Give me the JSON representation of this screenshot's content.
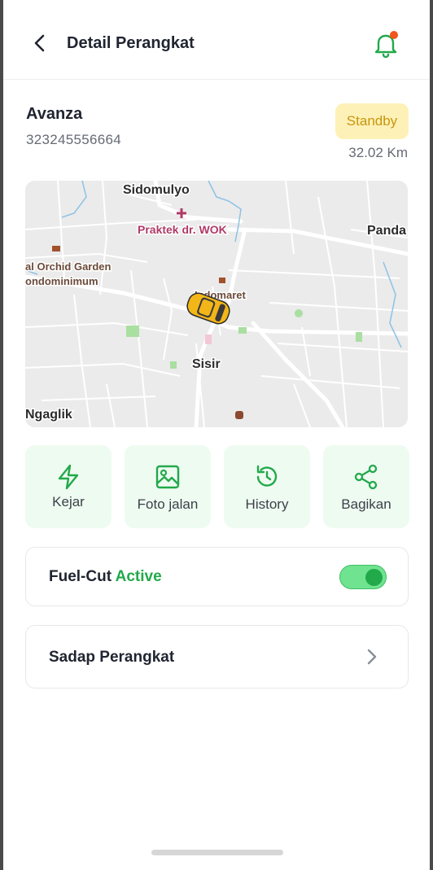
{
  "header": {
    "title": "Detail Perangkat",
    "back_icon": "arrow-left-icon",
    "notification_icon": "bell-icon",
    "notification_dot_color": "#f2541b",
    "accent": "#22a94b"
  },
  "vehicle": {
    "name": "Avanza",
    "id": "323245556664",
    "status": "Standby",
    "distance": "32.02 Km"
  },
  "map": {
    "labels": {
      "sidomulyo": "Sidomulyo",
      "praktek": "Praktek dr. WOK",
      "panda": "Panda",
      "orchid_line1": "al Orchid Garden",
      "orchid_line2": "ondominimum",
      "indomaret": "Indomaret",
      "sisir": "Sisir",
      "ngaglik": "Ngaglik"
    },
    "marker_icon": "car-icon"
  },
  "actions": [
    {
      "label": "Kejar",
      "icon": "lightning-icon"
    },
    {
      "label": "Foto jalan",
      "icon": "image-icon"
    },
    {
      "label": "History",
      "icon": "history-icon"
    },
    {
      "label": "Bagikan",
      "icon": "share-icon"
    }
  ],
  "fuel_cut": {
    "label": "Fuel-Cut",
    "status": "Active",
    "toggle_on": true
  },
  "tap_device": {
    "label": "Sadap Perangkat",
    "icon": "chevron-right-icon"
  }
}
